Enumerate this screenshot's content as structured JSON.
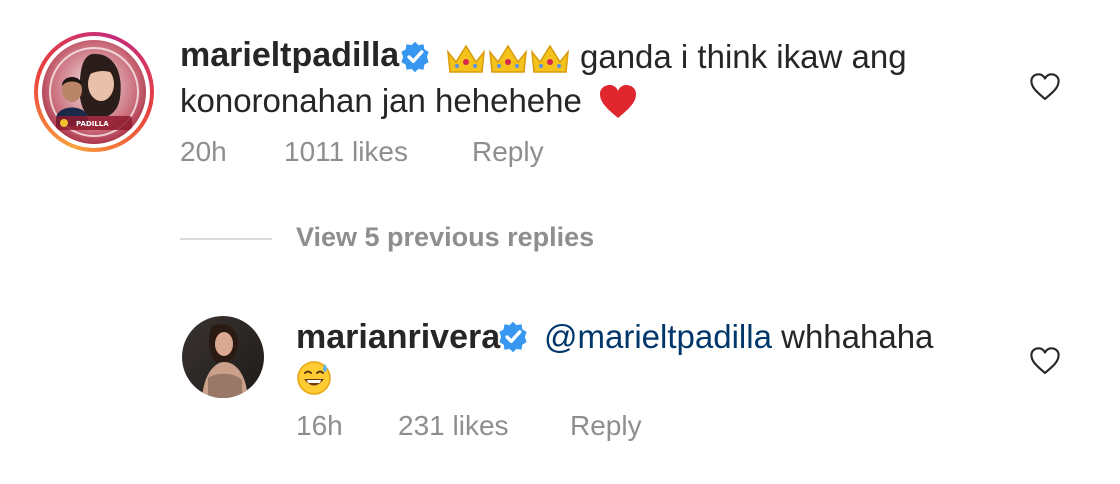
{
  "comments": [
    {
      "username": "marieltpadilla",
      "text_after_crowns": "ganda i think ikaw ang",
      "text_line2": "konoronahan jan hehehehe",
      "time": "20h",
      "likes": "1011 likes",
      "reply_label": "Reply"
    },
    {
      "username": "marianrivera",
      "mention": "@marieltpadilla",
      "text": "whhahaha",
      "time": "16h",
      "likes": "231 likes",
      "reply_label": "Reply"
    }
  ],
  "view_replies_label": "View 5 previous replies",
  "colors": {
    "text": "#262626",
    "meta": "#8e8e8e",
    "mention": "#00376b",
    "verified": "#3897f0",
    "heart_emoji": "#e0262f",
    "divider": "#dbdbdb"
  },
  "icons": {
    "verified": "verified-badge-icon",
    "like": "heart-outline-icon",
    "crown": "crown-emoji",
    "heart_emoji": "red-heart-emoji",
    "laugh_emoji": "grinning-sweat-emoji"
  }
}
